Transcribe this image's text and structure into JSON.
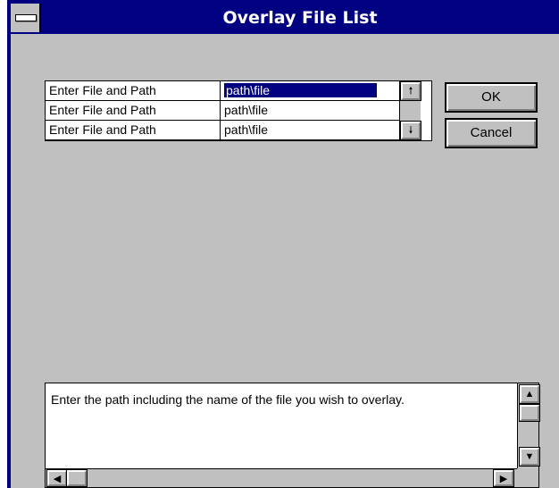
{
  "window": {
    "title": "Overlay File List",
    "system_menu_icon": "system-menu-icon"
  },
  "file_grid": {
    "rows": [
      {
        "label": "Enter File and Path",
        "value": "path\\file",
        "selected": true
      },
      {
        "label": "Enter File and Path",
        "value": "path\\file",
        "selected": false
      },
      {
        "label": "Enter File and Path",
        "value": "path\\file",
        "selected": false
      }
    ],
    "scroll_up_glyph": "🠕",
    "scroll_down_glyph": "🠗"
  },
  "buttons": {
    "ok_label": "OK",
    "cancel_label": "Cancel"
  },
  "help": {
    "text": "Enter the path including the name of the file you wish to overlay.",
    "up_glyph": "▲",
    "down_glyph": "▼",
    "left_glyph": "◀",
    "right_glyph": "▶"
  },
  "colors": {
    "titlebar": "#000080",
    "face": "#c0c0c0",
    "selection": "#000080"
  }
}
